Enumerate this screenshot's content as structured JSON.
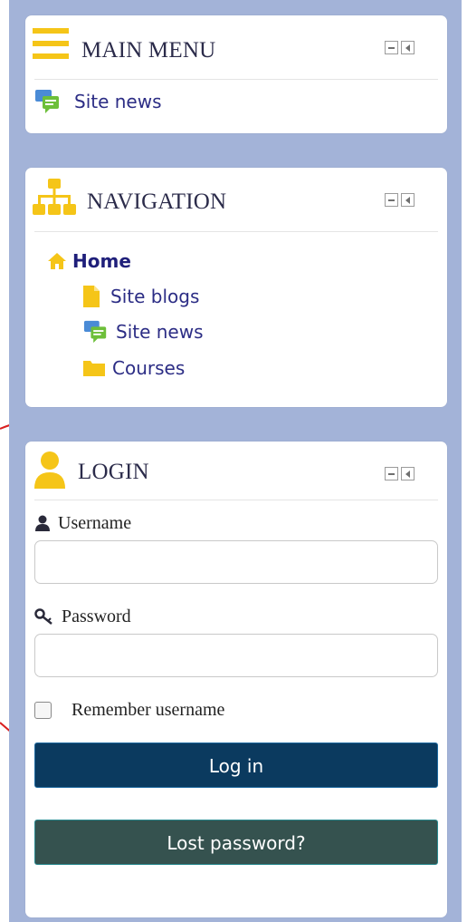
{
  "main_menu": {
    "title": "MAIN MENU",
    "items": [
      {
        "label": "Site news",
        "icon": "news-icon"
      }
    ]
  },
  "navigation": {
    "title": "NAVIGATION",
    "home_label": "Home",
    "items": [
      {
        "label": "Site blogs",
        "icon": "file-icon"
      },
      {
        "label": "Site news",
        "icon": "news-icon"
      },
      {
        "label": "Courses",
        "icon": "folder-icon"
      }
    ]
  },
  "login": {
    "title": "LOGIN",
    "username_label": "Username",
    "username_value": "",
    "password_label": "Password",
    "password_value": "",
    "remember_label": "Remember username",
    "remember_checked": false,
    "login_button": "Log in",
    "lost_password_button": "Lost password?"
  },
  "colors": {
    "rail": "#a3b3d8",
    "icon_yellow": "#f5c518",
    "link": "#2c2d85",
    "login_button": "#0b3a5f",
    "lost_password_button": "#35524f"
  }
}
